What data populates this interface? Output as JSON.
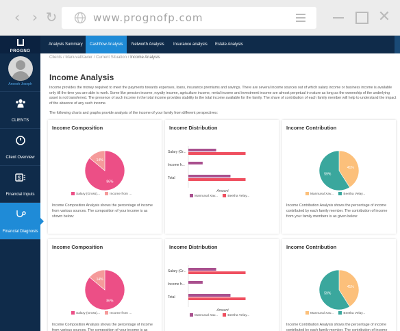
{
  "browser": {
    "url": "www.prognofp.com"
  },
  "brand": {
    "name": "PROGNO"
  },
  "user": {
    "name": "Aneesh Joseph"
  },
  "sidebar": {
    "items": [
      {
        "label": "CLIENTS",
        "icon": "clients-icon"
      },
      {
        "label": "Client Overview",
        "icon": "overview-icon"
      },
      {
        "label": "Financial Inputs",
        "icon": "financial-inputs-icon"
      },
      {
        "label": "Financial Diagnosis",
        "icon": "stethoscope-icon"
      }
    ]
  },
  "tabs": [
    {
      "label": "Analysis Summary"
    },
    {
      "label": "Cashflow Analysis"
    },
    {
      "label": "Networth Analysis"
    },
    {
      "label": "Insurance analysis"
    },
    {
      "label": "Estate Analysis"
    }
  ],
  "breadcrumb": {
    "items": [
      "Clients",
      "ManuvalXavier",
      "Current Situation",
      "Income Analysis"
    ]
  },
  "page": {
    "title": "Income Analysis",
    "intro": "Income provides the money required to meet the payments towards expenses, loans, insurance premiums and savings. There are several income sources out of which salary income or business income is available only till the time you are able to work. Some like pension income, royalty income, agriculture income, rental income and investment income are almost perpetual in nature as long as the ownership of the underlying asset is not transferred. The presence of such income in the total income provides stability to the total income available for the family. The share of contribution of each family member will help to understand the impact of the absence of any such income.",
    "sub_intro": "The following charts and graphs provide analysis of the income of your family from different perspectives:"
  },
  "colors": {
    "navy": "#0f2b4a",
    "accent": "#1f8bd7",
    "pink": "#ec4f86",
    "pink_light": "#f59a9a",
    "purple": "#a9508e",
    "red": "#ef4f5f",
    "orange": "#fcc07b",
    "teal": "#3aa79d"
  },
  "cards": {
    "composition": {
      "title": "Income Composition",
      "desc": "Income Composition Analysis shows the percentage of income from various sources. The composition of your income is as shown below:",
      "legend": [
        "Salary (Gross)...",
        "Income from ..."
      ],
      "slice_labels": [
        "86%",
        "14%"
      ]
    },
    "distribution": {
      "title": "Income Distribution",
      "categories": [
        "Salary (Gr...",
        "Income fr...",
        "Total"
      ],
      "xlabel": "Amount",
      "legend": [
        "Mannuval Xav...",
        "Beetha Velay..."
      ]
    },
    "contribution": {
      "title": "Income Contribution",
      "desc": "Income Contribution Analysis shows the percentage of income contributed by each family member. The contribution of income from your family members is as given below:",
      "legend": [
        "Mannuval Xav...",
        "Beetha Velay..."
      ],
      "slice_labels": [
        "41%",
        "59%"
      ]
    }
  },
  "chart_data": [
    {
      "type": "pie",
      "title": "Income Composition",
      "categories": [
        "Salary (Gross)...",
        "Income from ..."
      ],
      "values": [
        86,
        14
      ]
    },
    {
      "type": "bar",
      "orientation": "horizontal",
      "title": "Income Distribution",
      "categories": [
        "Salary (Gr...",
        "Income fr...",
        "Total"
      ],
      "xlabel": "Amount",
      "series": [
        {
          "name": "Mannuval Xav...",
          "values": [
            35,
            18,
            53
          ]
        },
        {
          "name": "Beetha Velay...",
          "values": [
            72,
            0,
            72
          ]
        }
      ]
    },
    {
      "type": "pie",
      "title": "Income Contribution",
      "categories": [
        "Mannuval Xav...",
        "Beetha Velay..."
      ],
      "values": [
        41,
        59
      ]
    }
  ]
}
